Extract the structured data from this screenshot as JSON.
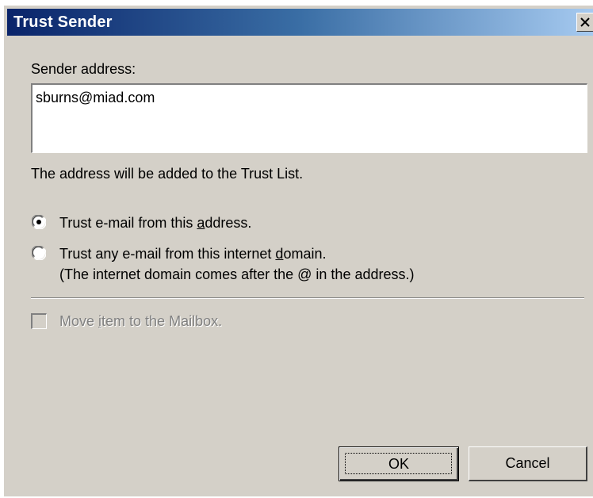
{
  "window": {
    "title": "Trust Sender",
    "close_label": "✕"
  },
  "sender": {
    "label": "Sender address:",
    "value": "sburns@miad.com"
  },
  "info_text": "The address will be added to the Trust List.",
  "options": {
    "trust_address": {
      "pre": "Trust e-mail from this ",
      "accel": "a",
      "post": "ddress.",
      "selected": true
    },
    "trust_domain": {
      "pre": "Trust any e-mail from this internet ",
      "accel": "d",
      "post": "omain.",
      "note": "(The internet domain comes after the @ in the address.)",
      "selected": false
    }
  },
  "move_checkbox": {
    "pre": "Move ",
    "accel": "i",
    "post": "tem to the Mailbox.",
    "checked": false,
    "disabled": true
  },
  "buttons": {
    "ok": "OK",
    "cancel": "Cancel"
  },
  "colors": {
    "dialog_bg": "#d4d0c8",
    "title_start": "#0a246a",
    "title_end": "#a6caf0"
  },
  "icons": {
    "close": "close-icon",
    "radio_selected": "radio-selected-icon",
    "radio_unselected": "radio-unselected-icon"
  }
}
